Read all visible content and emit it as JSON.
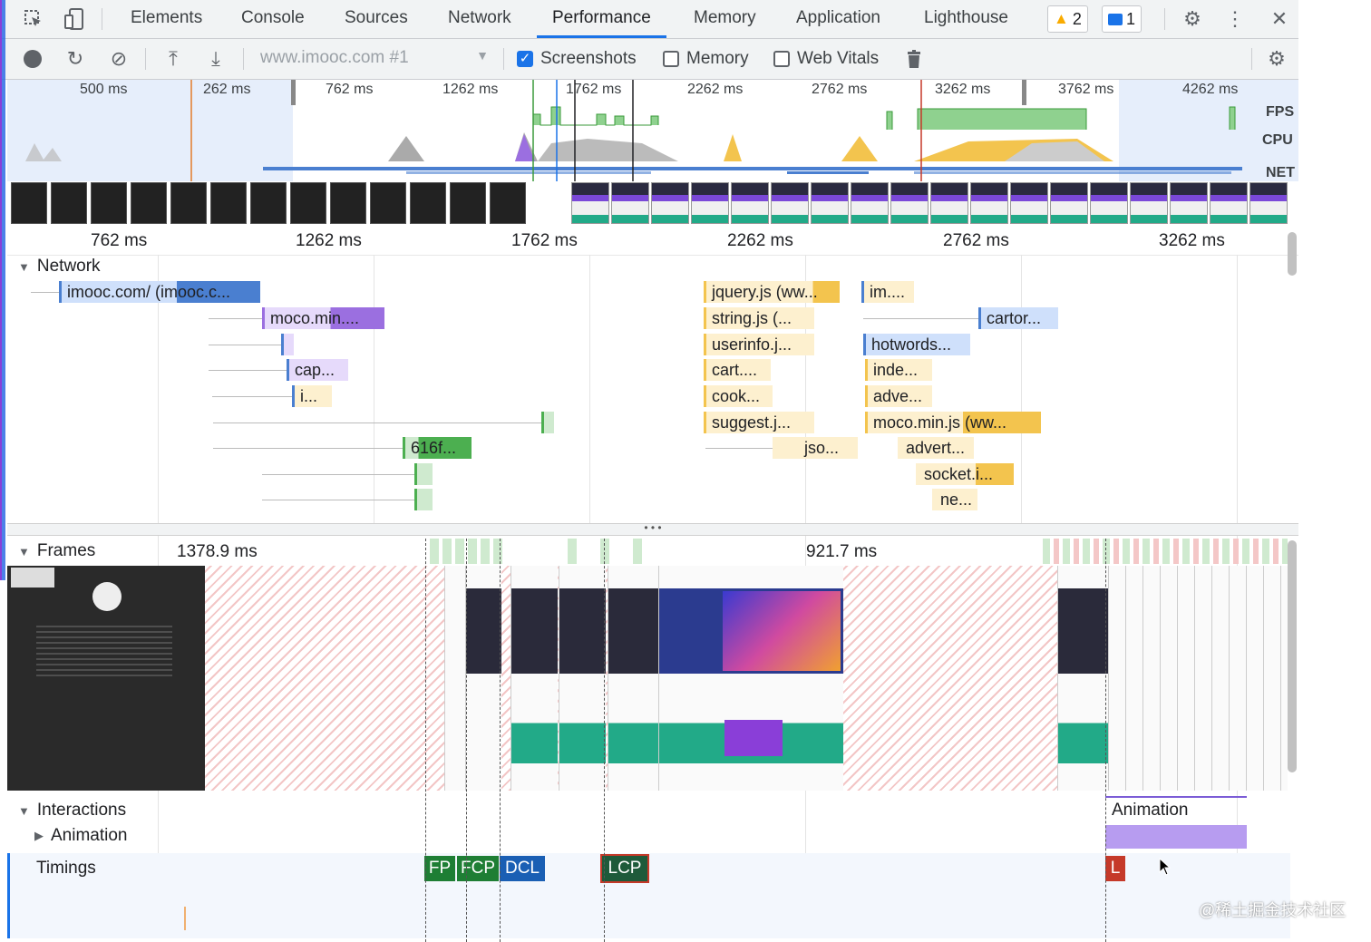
{
  "tabs": {
    "items": [
      "Elements",
      "Console",
      "Sources",
      "Network",
      "Performance",
      "Memory",
      "Application",
      "Lighthouse"
    ],
    "active": "Performance",
    "warnings_count": "2",
    "messages_count": "1"
  },
  "toolbar": {
    "profile_select": "www.imooc.com #1",
    "screenshots_label": "Screenshots",
    "screenshots_checked": true,
    "memory_label": "Memory",
    "memory_checked": false,
    "webvitals_label": "Web Vitals",
    "webvitals_checked": false
  },
  "overview": {
    "ticks": [
      "500 ms",
      "262 ms",
      "762 ms",
      "1262 ms",
      "1762 ms",
      "2262 ms",
      "2762 ms",
      "3262 ms",
      "3762 ms",
      "4262 ms"
    ],
    "fps_label": "FPS",
    "cpu_label": "CPU",
    "net_label": "NET"
  },
  "ruler": {
    "ticks": [
      "762 ms",
      "1262 ms",
      "1762 ms",
      "2262 ms",
      "2762 ms",
      "3262 ms"
    ]
  },
  "network": {
    "title": "Network",
    "requests": [
      "imooc.com/ (imooc.c...",
      "moco.min....",
      "cap...",
      "i...",
      "616f...",
      "jquery.js (ww...",
      "string.js (...",
      "userinfo.j...",
      "cart....",
      "cook...",
      "suggest.j...",
      "jso...",
      "im....",
      "cartor...",
      "hotwords...",
      "inde...",
      "adve...",
      "moco.min.js (ww...",
      "advert...",
      "socket.i...",
      "ne..."
    ]
  },
  "frames": {
    "title": "Frames",
    "duration1": "1378.9 ms",
    "duration2": "921.7 ms"
  },
  "interactions": {
    "title": "Interactions",
    "child": "Animation",
    "bar_label": "Animation"
  },
  "timings": {
    "title": "Timings",
    "markers": [
      "FP",
      "FCP",
      "DCL",
      "LCP",
      "L"
    ]
  },
  "colors": {
    "accent": "#1a73e8",
    "script": "#f3c44e",
    "html": "#4a7fd0",
    "css": "#9b6fe0",
    "image": "#4caf50"
  },
  "watermark": "@稀土掘金技术社区"
}
